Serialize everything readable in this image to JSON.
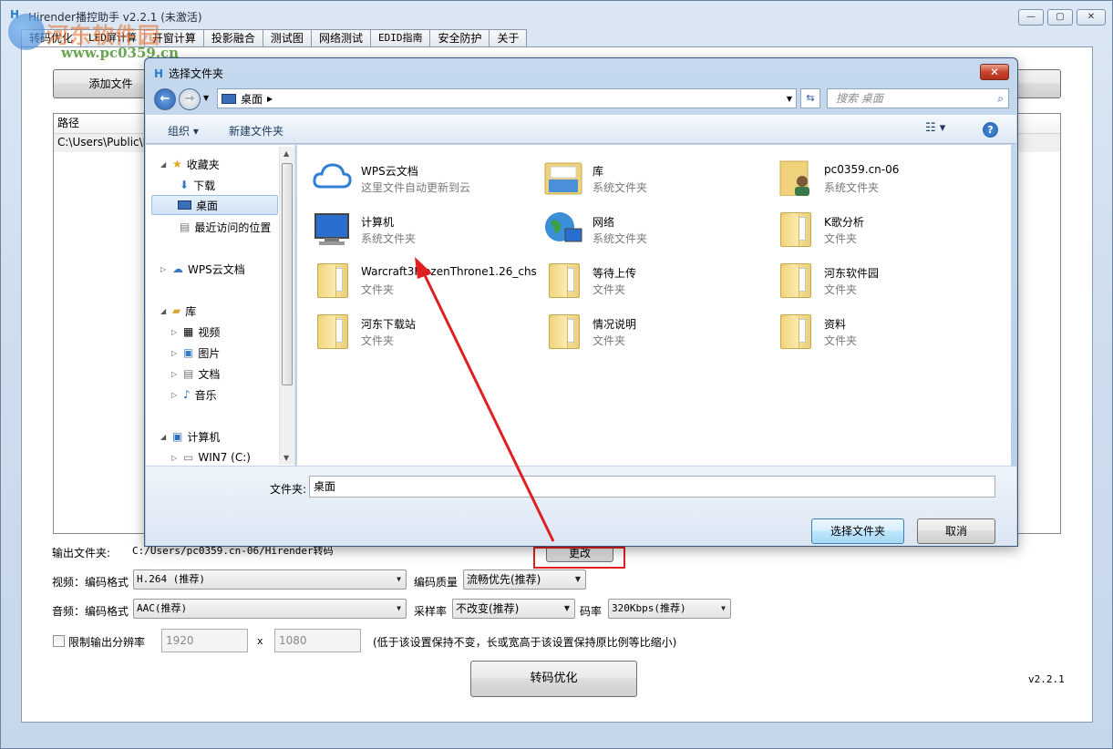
{
  "app": {
    "title": "Hirender播控助手 v2.2.1 (未激活)",
    "controls": {
      "minimize": "▭",
      "maximize": "▭",
      "close": "✕"
    }
  },
  "watermark": {
    "text1": "河东软件园",
    "text2": "www.pc0359.cn"
  },
  "tabs": [
    "转码优化",
    "LED屏计算",
    "开窗计算",
    "投影融合",
    "测试图",
    "网络测试",
    "EDID指南",
    "安全防护",
    "关于"
  ],
  "main": {
    "add_file_label": "添加文件",
    "list_header": "路径",
    "list_rows": [
      "C:\\Users\\Public\\P"
    ],
    "output_label": "输出文件夹:",
    "output_path": "C:/Users/pc0359.cn-06/Hirender转码",
    "change_label": "更改",
    "video_label": "视频：编码格式",
    "video_codec": "H.264 (推荐)",
    "quality_label": "编码质量",
    "quality_value": "流畅优先(推荐)",
    "audio_label": "音频：编码格式",
    "audio_codec": "AAC(推荐)",
    "samplerate_label": "采样率",
    "samplerate_value": "不改变(推荐)",
    "bitrate_label": "码率",
    "bitrate_value": "320Kbps(推荐)",
    "limit_label": "限制输出分辨率",
    "width_value": "1920",
    "x_label": "x",
    "height_value": "1080",
    "limit_note": "(低于该设置保持不变，长或宽高于该设置保持原比例等比缩小)",
    "convert_label": "转码优化",
    "version": "v2.2.1"
  },
  "dialog": {
    "title": "选择文件夹",
    "close": "✕",
    "address": "桌面",
    "search_placeholder": "搜索 桌面",
    "organize": "组织 ▾",
    "new_folder": "新建文件夹",
    "help": "?",
    "nav": {
      "favorites": "收藏夹",
      "downloads": "下载",
      "desktop": "桌面",
      "recent": "最近访问的位置",
      "wps": "WPS云文档",
      "library": "库",
      "videos": "视频",
      "pictures": "图片",
      "documents": "文档",
      "music": "音乐",
      "computer": "计算机",
      "drive_c": "WIN7 (C:)"
    },
    "items": [
      {
        "name": "WPS云文档",
        "sub": "这里文件自动更新到云",
        "icon": "cloud-icon"
      },
      {
        "name": "库",
        "sub": "系统文件夹",
        "icon": "library-icon"
      },
      {
        "name": "pc0359.cn-06",
        "sub": "系统文件夹",
        "icon": "user-folder-icon"
      },
      {
        "name": "计算机",
        "sub": "系统文件夹",
        "icon": "computer-icon"
      },
      {
        "name": "网络",
        "sub": "系统文件夹",
        "icon": "network-icon"
      },
      {
        "name": "K歌分析",
        "sub": "文件夹",
        "icon": "folder-icon"
      },
      {
        "name": "Warcraft3FrozenThrone1.26_chs",
        "sub": "文件夹",
        "icon": "folder-icon"
      },
      {
        "name": "等待上传",
        "sub": "文件夹",
        "icon": "folder-icon"
      },
      {
        "name": "河东软件园",
        "sub": "文件夹",
        "icon": "folder-icon"
      },
      {
        "name": "河东下载站",
        "sub": "文件夹",
        "icon": "folder-icon"
      },
      {
        "name": "情况说明",
        "sub": "文件夹",
        "icon": "folder-icon"
      },
      {
        "name": "资料",
        "sub": "文件夹",
        "icon": "folder-icon"
      }
    ],
    "folder_label": "文件夹:",
    "folder_value": "桌面",
    "select_button": "选择文件夹",
    "cancel_button": "取消"
  },
  "colors": {
    "annotation": "#e02020",
    "accent": "#2a7fcf"
  }
}
